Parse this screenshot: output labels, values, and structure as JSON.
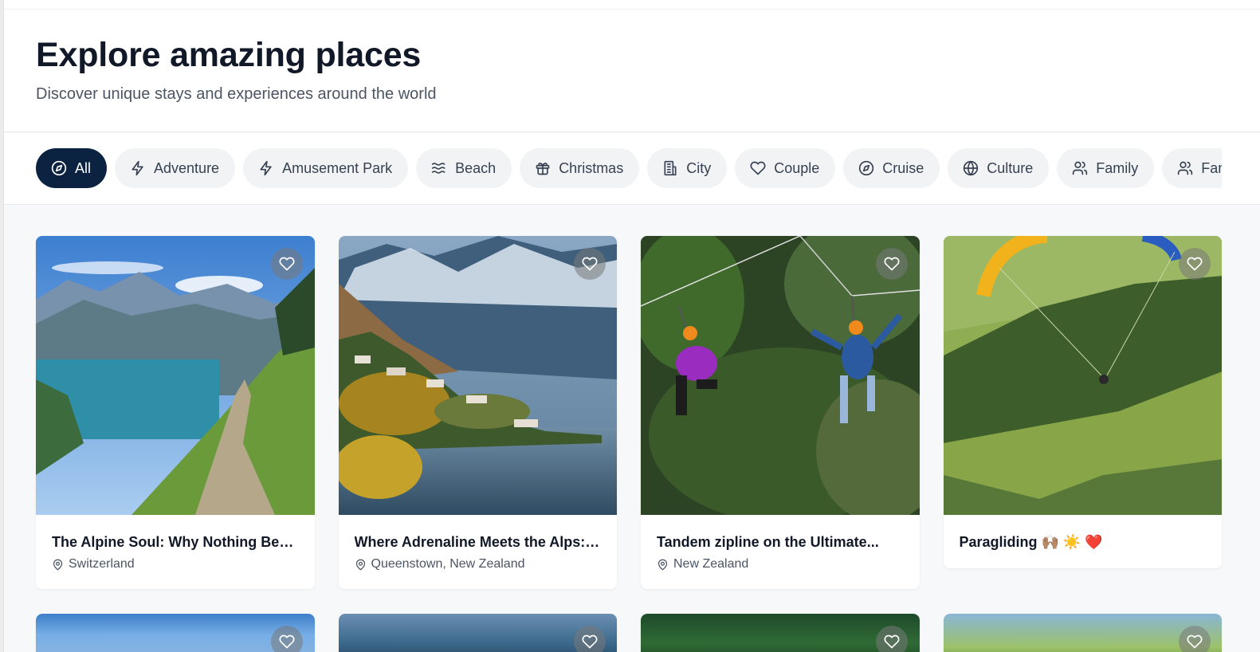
{
  "header": {
    "title": "Explore amazing places",
    "subtitle": "Discover unique stays and experiences around the world"
  },
  "categories": [
    {
      "label": "All",
      "icon": "compass-icon",
      "active": true
    },
    {
      "label": "Adventure",
      "icon": "bolt-icon",
      "active": false
    },
    {
      "label": "Amusement Park",
      "icon": "bolt-icon",
      "active": false
    },
    {
      "label": "Beach",
      "icon": "waves-icon",
      "active": false
    },
    {
      "label": "Christmas",
      "icon": "gift-icon",
      "active": false
    },
    {
      "label": "City",
      "icon": "building-icon",
      "active": false
    },
    {
      "label": "Couple",
      "icon": "heart-icon",
      "active": false
    },
    {
      "label": "Cruise",
      "icon": "compass-icon",
      "active": false
    },
    {
      "label": "Culture",
      "icon": "globe-icon",
      "active": false
    },
    {
      "label": "Family",
      "icon": "users-icon",
      "active": false
    },
    {
      "label": "Family Trip",
      "icon": "users-icon",
      "active": false
    }
  ],
  "listings": [
    {
      "title": "The Alpine Soul: Why Nothing Bea...",
      "location": "Switzerland"
    },
    {
      "title": "Where Adrenaline Meets the Alps: ...",
      "location": "Queenstown, New Zealand"
    },
    {
      "title": "Tandem zipline on the Ultimate...",
      "location": "New Zealand"
    },
    {
      "title": "Paragliding 🙌🏽 ☀️ ❤️",
      "location": ""
    }
  ],
  "colors": {
    "accent": "#0b2340",
    "chip_bg": "#f1f3f5",
    "page_bg": "#f7f8fa"
  }
}
